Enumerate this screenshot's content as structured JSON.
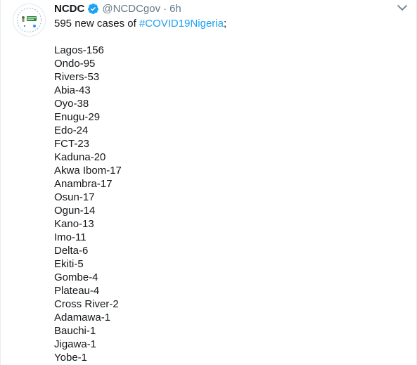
{
  "author": {
    "display_name": "NCDC",
    "handle": "@NCDCgov",
    "separator": "·",
    "time": "6h"
  },
  "icons": {
    "avatar": "ncdc-logo",
    "verified": "verified-badge-icon",
    "menu": "chevron-down-icon"
  },
  "colors": {
    "link": "#1da1f2",
    "text": "#14171a",
    "muted": "#657786"
  },
  "tweet": {
    "intro_prefix": "595 new cases of ",
    "hashtag": "#COVID19Nigeria",
    "intro_suffix": ";",
    "cases": [
      "Lagos-156",
      "Ondo-95",
      "Rivers-53",
      "Abia-43",
      "Oyo-38",
      "Enugu-29",
      "Edo-24",
      "FCT-23",
      "Kaduna-20",
      "Akwa Ibom-17",
      "Anambra-17",
      "Osun-17",
      "Ogun-14",
      "Kano-13",
      "Imo-11",
      "Delta-6",
      "Ekiti-5",
      "Gombe-4",
      "Plateau-4",
      "Cross River-2",
      "Adamawa-1",
      "Bauchi-1",
      "Jigawa-1",
      "Yobe-1"
    ]
  }
}
